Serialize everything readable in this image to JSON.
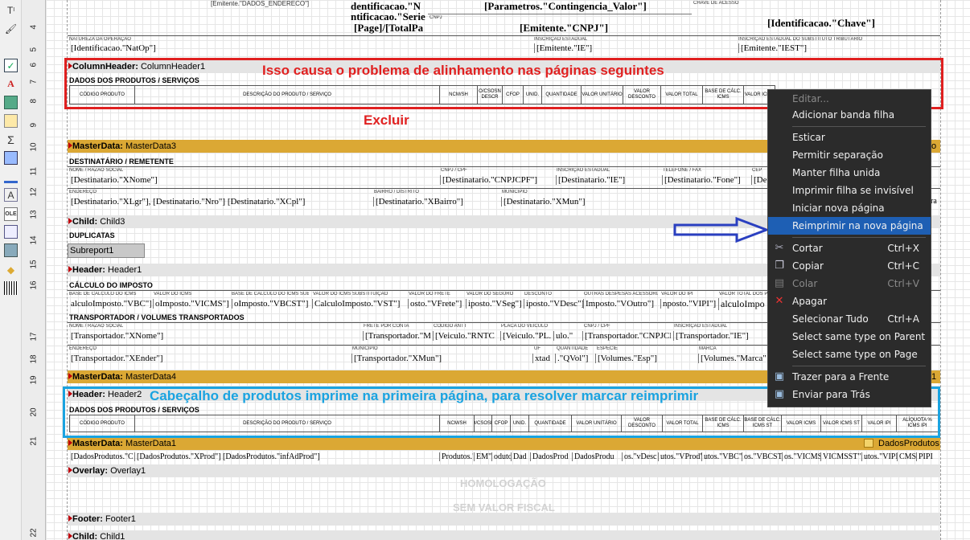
{
  "ruler": [
    "4",
    "5",
    "6",
    "7",
    "8",
    "9",
    "10",
    "11",
    "12",
    "13",
    "14",
    "15",
    "16",
    "17",
    "18",
    "19",
    "20",
    "21",
    "22"
  ],
  "toolbar_icons": [
    "text-tool-icon",
    "brush-icon",
    "checkbox-tool-icon",
    "rich-text-icon",
    "picture-icon",
    "subreport-icon",
    "sum-icon",
    "shape-icon",
    "line-icon",
    "barcode-text-icon",
    "ole-icon",
    "crosstab-icon",
    "chart-icon",
    "map-icon",
    "barcode-icon"
  ],
  "top": {
    "emitente_endereco": "[Emitente.\"DADOS_ENDERECO\"]",
    "ident_n": "dentificacao.\"N",
    "ident_serie": "ntificacao.\"Serie",
    "page_total": "[Page]/[TotalPa",
    "contingencia": "[Parametros.\"Contingencia_Valor\"]",
    "cnpj_label": "CNPJ",
    "emitente_cnpj": "[Emitente.\"CNPJ\"]",
    "chave_label": "CHAVE DE ACESSO",
    "chave": "[Identificacao.\"Chave\"]",
    "natop_label": "NATUREZA DA OPERAÇÃO",
    "natop": "[Identificacao.\"NatOp\"]",
    "ie_label": "INSCRIÇÃO ESTADUAL",
    "ie": "[Emitente.\"IE\"]",
    "iest_label": "INSCRIÇÃO ESTADUAL DO SUBSTITUTO TRIBUTÁRIO",
    "iest": "[Emitente.\"IEST\"]"
  },
  "bands": {
    "column_header": {
      "type": "ColumnHeader:",
      "name": "ColumnHeader1"
    },
    "master_data3": {
      "type": "MasterData:",
      "name": "MasterData3",
      "tail": "o"
    },
    "child3": {
      "type": "Child:",
      "name": "Child3"
    },
    "header1": {
      "type": "Header:",
      "name": "Header1"
    },
    "master_data4": {
      "type": "MasterData:",
      "name": "MasterData4",
      "tail": "1"
    },
    "header2": {
      "type": "Header:",
      "name": "Header2"
    },
    "master_data1": {
      "type": "MasterData:",
      "name": "MasterData1",
      "datasource": "DadosProdutos"
    },
    "overlay1": {
      "type": "Overlay:",
      "name": "Overlay1"
    },
    "footer1": {
      "type": "Footer:",
      "name": "Footer1"
    },
    "child1": {
      "type": "Child:",
      "name": "Child1"
    }
  },
  "products_title": "DADOS DOS PRODUTOS / SERVIÇOS",
  "product_cols1": [
    "CÓDIGO PRODUTO",
    "DESCRIÇÃO DO PRODUTO / SERVIÇO",
    "NCM/SH",
    "O/CSOSN DESCR",
    "CFOP",
    "UNID.",
    "QUANTIDADE",
    "VALOR UNITÁRIO",
    "VALOR DESCONTO",
    "VALOR TOTAL",
    "BASE DE CÁLC. ICMS",
    "VALOR ICMS"
  ],
  "product_cols2": [
    "CÓDIGO PRODUTO",
    "DESCRIÇÃO DO PRODUTO / SERVIÇO",
    "NCM/SH",
    "O/CSOSN",
    "CFOP",
    "UNID.",
    "QUANTIDADE",
    "VALOR UNITÁRIO",
    "VALOR DESCONTO",
    "VALOR TOTAL",
    "BASE DE CÁLC. ICMS",
    "BASE DE CÁLC. ICMS ST",
    "VALOR ICMS",
    "VALOR ICMS ST",
    "VALOR IPI",
    "ALÍQUOTA % ICMS IPI"
  ],
  "dest": {
    "title": "DESTINATÁRIO / REMETENTE",
    "nome_label": "NOME / RAZÃO SOCIAL",
    "nome": "[Destinatario.\"XNome\"]",
    "cnpj_label": "CNPJ / CPF",
    "cnpj": "[Destinatario.\"CNPJCPF\"]",
    "ie_label": "INSCRIÇÃO ESTADUAL",
    "ie": "[Destinatario.\"IE\"]",
    "fone_label": "TELEFONE / FAX",
    "fone": "[Destinatario.\"Fone\"]",
    "cep_label": "CEP",
    "cep": "[De",
    "end_label": "ENDEREÇO",
    "end": "[Destinatario.\"XLgr\"], [Destinatario.\"Nro\"]  [Destinatario.\"XCpl\"]",
    "bairro_label": "BAIRRO / DISTRITO",
    "bairro": "[Destinatario.\"XBairro\"]",
    "mun_label": "MUNICÍPIO",
    "mun": "[Destinatario.\"XMun\"]",
    "uf_tail": "ra"
  },
  "duplicatas": "DUPLICATAS",
  "subreport": "Subreport1",
  "calc": {
    "title": "CÁLCULO DO IMPOSTO",
    "labels": [
      "BASE DE CÁLCULO DO ICMS",
      "VALOR DO ICMS",
      "BASE DE CÁLCULO DO ICMS SUBST.",
      "VALOR DO ICMS SUBSTITUIÇÃO",
      "VALOR DO FRETE",
      "VALOR DO SEGURO",
      "DESCONTO",
      "OUTRAS DESPESAS ACESSÓRIAS",
      "VALOR DO IPI",
      "VALOR TOTAL DOS PRODUTOS"
    ],
    "values": [
      "alculoImposto.\"VBC\"]",
      "oImposto.\"VICMS\"]",
      "oImposto.\"VBCST\"]",
      "CalculoImposto.\"VST\"]",
      "osto.\"VFrete\"]",
      "iposto.\"VSeg\"]",
      "iposto.\"VDesc\"]",
      "Imposto.\"VOutro\"]",
      "nposto.\"VIPI\"]",
      "alculoImpo"
    ]
  },
  "transp": {
    "title": "TRANSPORTADOR / VOLUMES TRANSPORTADOS",
    "nome_label": "NOME / RAZÃO SOCIAL",
    "nome": "[Transportador.\"XNome\"]",
    "frete_label": "FRETE POR CONTA",
    "frete": "[Transportador.\"M",
    "antt_label": "CÓDIGO ANTT",
    "antt": "[Veiculo.\"RNTC",
    "placa_label": "PLACA DO VEÍCULO",
    "placa": "[Veiculo.\"PL.",
    "uf": "ulo.\"",
    "cnpj_label": "CNPJ / CPF",
    "cnpj": "[Transportador.\"CNPJCP",
    "ie_label": "INSCRIÇÃO ESTADUAL",
    "ie": "[Transportador.\"IE\"]",
    "end_label": "ENDEREÇO",
    "end": "[Transportador.\"XEnder\"]",
    "mun_label": "MUNICÍPIO",
    "mun": "[Transportador.\"XMun\"]",
    "uf_label": "UF",
    "uf2": "xtad",
    "qtd_label": "QUANTIDADE",
    "qtd": ".\"QVol\"]",
    "esp_label": "ESPÉCIE",
    "esp": "[Volumes.\"Esp\"]",
    "marca_label": "MARCA",
    "marca": "[Volumes.\"Marca\""
  },
  "detail_row": [
    "[DadosProdutos.\"CP",
    "[DadosProdutos.\"XProd\"] [DadosProdutos.\"infAdProd\"]",
    "Produtos.\"",
    "EM\"",
    "oduto",
    "Dad",
    "DadosProd",
    "DadosProdu",
    "os.\"vDesc\"",
    "utos.\"VProd\"",
    "utos.\"VBC\"",
    "os.\"VBCST\"",
    "os.\"VICMS\"",
    "VICMSST\"",
    "utos.\"VIPI\"",
    "CMS\"",
    "PIPI"
  ],
  "overlay_text1": "HOMOLOGAÇÃO",
  "overlay_text2": "SEM VALOR FISCAL",
  "annotations": {
    "top": "Isso causa o problema de alinhamento nas páginas seguintes",
    "excluir": "Excluir",
    "bottom": "Cabeçalho de produtos imprime na primeira página, para resolver marcar reimprimir"
  },
  "colors": {
    "red": "#e02020",
    "blue": "#1aa3e0",
    "arrow": "#2a3fc0",
    "gold": "#dba834"
  },
  "menu": {
    "items": [
      {
        "label": "Editar...",
        "shortcut": "",
        "disabled": true,
        "icon": ""
      },
      {
        "label": "Adicionar banda filha",
        "shortcut": "",
        "disabled": false,
        "icon": ""
      },
      {
        "label": "Esticar",
        "shortcut": "",
        "disabled": false,
        "icon": ""
      },
      {
        "label": "Permitir separação",
        "shortcut": "",
        "disabled": false,
        "icon": ""
      },
      {
        "label": "Manter filha unida",
        "shortcut": "",
        "disabled": false,
        "icon": ""
      },
      {
        "label": "Imprimir filha se invisível",
        "shortcut": "",
        "disabled": false,
        "icon": ""
      },
      {
        "label": "Iniciar nova página",
        "shortcut": "",
        "disabled": false,
        "icon": ""
      },
      {
        "label": "Reimprimir na nova página",
        "shortcut": "",
        "disabled": false,
        "icon": "",
        "selected": true
      },
      {
        "label": "Cortar",
        "shortcut": "Ctrl+X",
        "disabled": false,
        "icon": "scissors-icon"
      },
      {
        "label": "Copiar",
        "shortcut": "Ctrl+C",
        "disabled": false,
        "icon": "copy-icon"
      },
      {
        "label": "Colar",
        "shortcut": "Ctrl+V",
        "disabled": true,
        "icon": "paste-icon"
      },
      {
        "label": "Apagar",
        "shortcut": "",
        "disabled": false,
        "icon": "delete-icon"
      },
      {
        "label": "Selecionar Tudo",
        "shortcut": "Ctrl+A",
        "disabled": false,
        "icon": ""
      },
      {
        "label": "Select same type on Parent",
        "shortcut": "",
        "disabled": false,
        "icon": ""
      },
      {
        "label": "Select same type on Page",
        "shortcut": "",
        "disabled": false,
        "icon": ""
      },
      {
        "label": "Trazer para a Frente",
        "shortcut": "",
        "disabled": false,
        "icon": "bring-front-icon"
      },
      {
        "label": "Enviar para Trás",
        "shortcut": "",
        "disabled": false,
        "icon": "send-back-icon"
      }
    ]
  }
}
